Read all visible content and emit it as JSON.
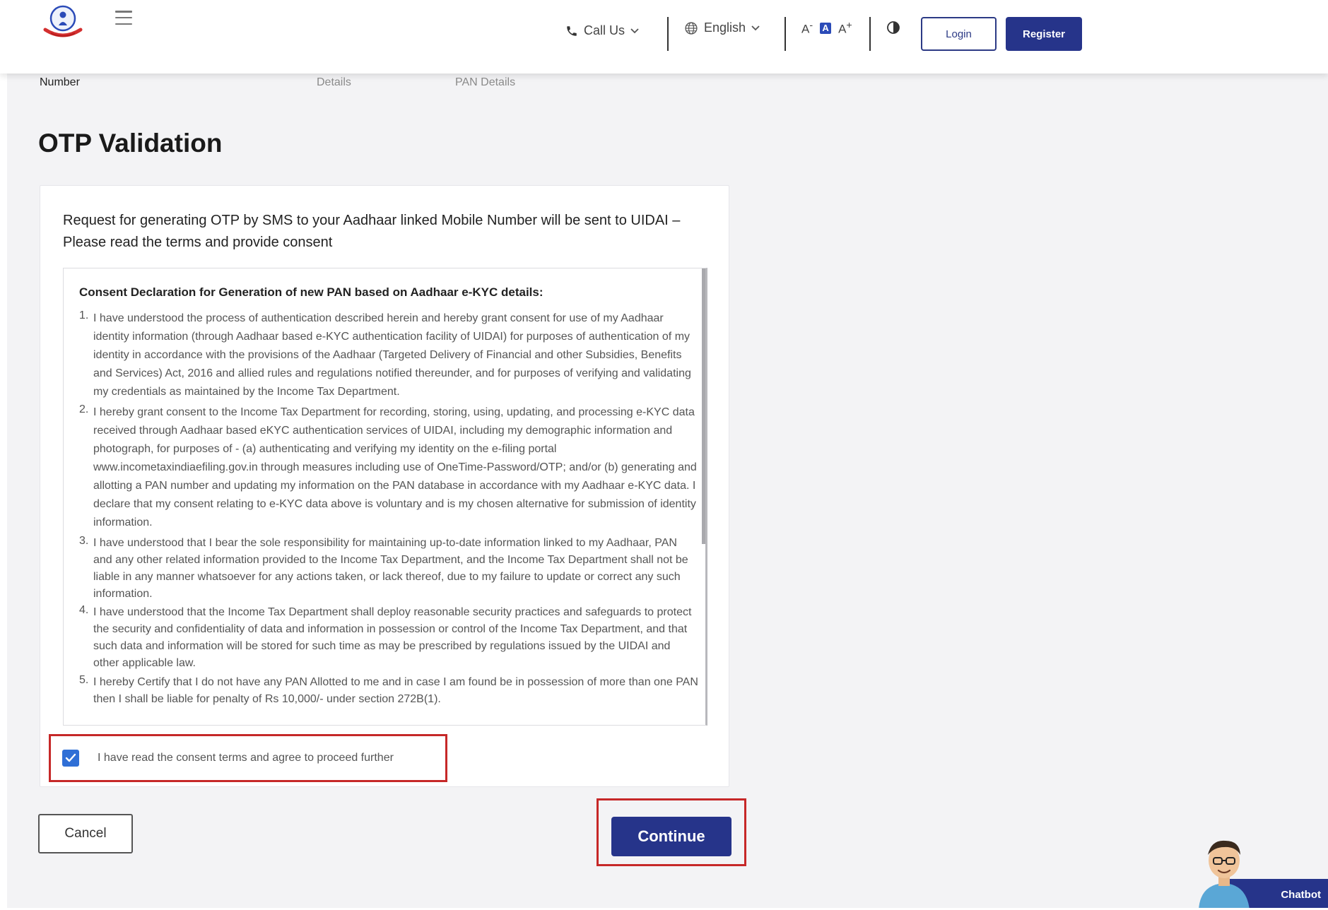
{
  "header": {
    "call_us": "Call Us",
    "language": "English",
    "font_decrease": "A",
    "font_normal": "A",
    "font_increase": "A",
    "login": "Login",
    "register": "Register"
  },
  "steps": {
    "step1": "Number",
    "step2": "Details",
    "step3": "PAN Details"
  },
  "page_title": "OTP Validation",
  "card": {
    "intro": "Request for generating OTP by SMS to your Aadhaar linked Mobile Number will be sent to UIDAI – Please read the terms and provide consent",
    "consent_heading": "Consent Declaration for Generation of new PAN based on Aadhaar e-KYC details:",
    "items": [
      {
        "num": "1.",
        "text": "I have understood the process of authentication described herein and hereby grant consent for use of my Aadhaar identity information (through Aadhaar based e-KYC authentication facility of UIDAI) for purposes of authentication of my identity in accordance with the provisions of the Aadhaar (Targeted Delivery of Financial and other Subsidies, Benefits and Services) Act, 2016 and allied rules and regulations notified thereunder, and for purposes of verifying and validating my credentials as maintained by the Income Tax Department."
      },
      {
        "num": "2.",
        "text": "I hereby grant consent to the Income Tax Department for recording, storing, using, updating, and processing e-KYC data received through Aadhaar based eKYC authentication services of UIDAI, including my demographic information and photograph, for purposes of - (a) authenticating and verifying my identity on the e-filing portal www.incometaxindiaefiling.gov.in through measures including use of OneTime-Password/OTP; and/or (b) generating and allotting a PAN number and updating my information on the PAN database in accordance with my Aadhaar e-KYC data. I declare that my consent relating to e-KYC data above is voluntary and is my chosen alternative for submission of identity information."
      },
      {
        "num": "3.",
        "text": "I have understood that I bear the sole responsibility for maintaining up-to-date information linked to my Aadhaar, PAN and any other related information provided to the Income Tax Department, and the Income Tax Department shall not be liable in any manner whatsoever for any actions taken, or lack thereof, due to my failure to update or correct any such information."
      },
      {
        "num": "4.",
        "text": "I have understood that the Income Tax Department shall deploy reasonable security practices and safeguards to protect the security and confidentiality of data and information in possession or control of the Income Tax Department, and that such data and information will be stored for such time as may be prescribed by regulations issued by the UIDAI and other applicable law."
      },
      {
        "num": "5.",
        "text": "I hereby Certify that I do not have any PAN Allotted to me and in case I am found be in possession of more than one PAN then I shall be liable for penalty of Rs 10,000/- under section 272B(1)."
      }
    ],
    "checkbox_label": "I have read the consent terms and agree to proceed further",
    "checkbox_checked": true
  },
  "actions": {
    "cancel": "Cancel",
    "continue": "Continue"
  },
  "chatbot": {
    "label": "Chatbot"
  },
  "colors": {
    "primary": "#26348a",
    "highlight": "#c62828",
    "checkbox": "#2f6fd6"
  },
  "icons": {
    "logo": "emblem-logo-icon",
    "menu": "hamburger-menu-icon",
    "phone": "phone-icon",
    "globe": "globe-icon",
    "chevron": "chevron-down-icon",
    "contrast": "contrast-icon",
    "check": "checkmark-icon"
  }
}
